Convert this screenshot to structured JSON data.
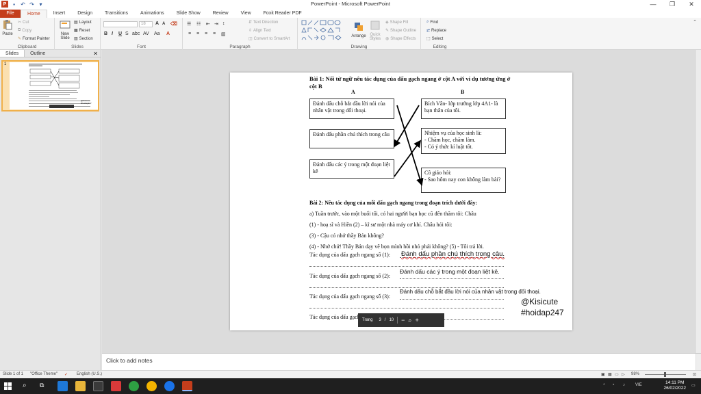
{
  "window": {
    "title": "PowerPoint - Microsoft PowerPoint",
    "controls": [
      "—",
      "❐",
      "✕"
    ]
  },
  "ribbon_tabs": [
    "File",
    "Home",
    "Insert",
    "Design",
    "Transitions",
    "Animations",
    "Slide Show",
    "Review",
    "View",
    "Foxit Reader PDF"
  ],
  "active_tab": "Home",
  "ribbon": {
    "clipboard": {
      "label": "Clipboard",
      "paste": "Paste",
      "cut": "Cut",
      "copy": "Copy",
      "format_painter": "Format Painter"
    },
    "slides": {
      "label": "Slides",
      "new_slide": "New Slide",
      "layout": "Layout",
      "reset": "Reset",
      "section": "Section"
    },
    "font": {
      "label": "Font",
      "size": "18"
    },
    "paragraph": {
      "label": "Paragraph",
      "text_direction": "Text Direction",
      "align_text": "Align Text",
      "convert_smartart": "Convert to SmartArt"
    },
    "drawing": {
      "label": "Drawing",
      "arrange": "Arrange",
      "quick_styles": "Quick Styles",
      "shape_fill": "Shape Fill",
      "shape_outline": "Shape Outline",
      "shape_effects": "Shape Effects"
    },
    "editing": {
      "label": "Editing",
      "find": "Find",
      "replace": "Replace",
      "select": "Select"
    }
  },
  "left_panel": {
    "tabs": [
      "Slides",
      "Outline"
    ],
    "slide_number": "1"
  },
  "slide": {
    "bai1_title": "Bài 1: Nối từ ngữ nêu tác dụng của dấu gạch ngang ở cột A với ví dụ tương ứng ở cột B",
    "col_a": "A",
    "col_b": "B",
    "a_items": [
      "Đánh dấu chỗ bắt đầu lời nói của nhân vật trong đối thoại.",
      "Đánh dấu phần chú thích trong câu",
      "Đánh dấu các ý trong một đoạn liệt kê"
    ],
    "b_items": [
      "Bích Vân- lớp trưởng lớp 4A1- là bạn thân của tôi.",
      "Nhiệm vụ của học sinh là:\n- Chăm học, chăm làm.\n- Có ý thức kỉ luật tốt.",
      "Cô giáo hỏi:\n- Sao hôm nay con không làm bài?"
    ],
    "bai2_title": "Bài 2: Nêu tác dụng của mỗi dấu gạch ngang trong đoạn trích dưới đây:",
    "passage": [
      "a)      Tuần trước, vào một buổi tối, có hai người bạn học cũ đến thăm tôi: Châu",
      "(1) - hoạ sĩ và Hiền (2) – kĩ sư một nhà máy cơ khí. Châu hỏi tôi:",
      "  (3)  - Cậu có nhớ thầy Bản không?",
      " (4) - Nhớ chứ! Thầy Bản dạy vẽ bọn mình hồi nhỏ phải không? (5) - Tôi trả lời."
    ],
    "q1": "Tác dụng của dấu gạch ngang số (1):",
    "q2": "Tác dụng của dấu gạch ngang số (2):",
    "q3": "Tác dụng của dấu gạch ngang số (3):",
    "q4": "Tác dụng của dấu gạch ngang số (4):",
    "a1": "Đánh dấu phần chú thích trong câu.",
    "a2": "Đánh dấu các ý trong một đoạn liệt kê.",
    "a3": "Đánh dấu chỗ bắt đầu lời nói của nhân vật trong đối thoại.",
    "watermark_1": "@Kisicute",
    "watermark_2": "#hoidap247"
  },
  "pager": {
    "label": "Trang",
    "current": "3",
    "sep": "/",
    "total": "10"
  },
  "notes_placeholder": "Click to add notes",
  "status": {
    "slide_of": "Slide 1 of 1",
    "theme": "\"Office Theme\"",
    "language": "English (U.S.)",
    "zoom": "98%"
  },
  "taskbar": {
    "lang": "VIE",
    "time": "14:11 PM",
    "date": "26/02/2022"
  }
}
